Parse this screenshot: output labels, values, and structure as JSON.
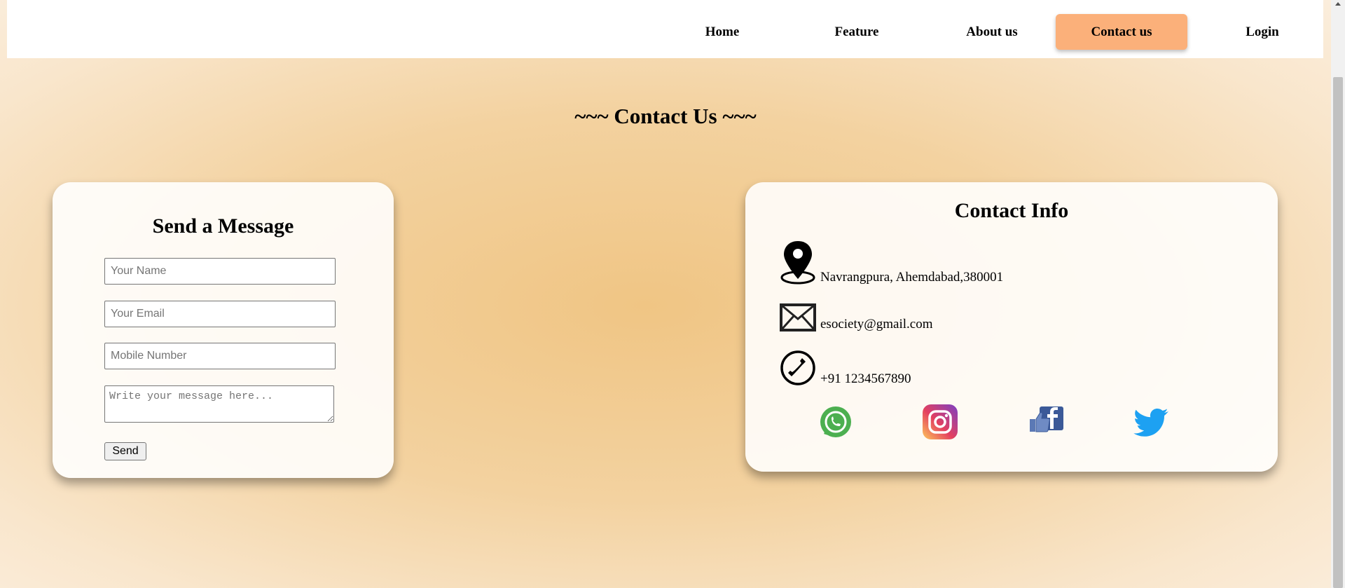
{
  "nav": {
    "items": [
      {
        "label": "Home"
      },
      {
        "label": "Feature"
      },
      {
        "label": "About us"
      },
      {
        "label": "Contact us"
      },
      {
        "label": "Login"
      }
    ]
  },
  "page_title": "~~~ Contact Us ~~~",
  "message_form": {
    "title": "Send a Message",
    "name_placeholder": "Your Name",
    "email_placeholder": "Your Email",
    "mobile_placeholder": "Mobile Number",
    "message_placeholder": "Write your message here...",
    "send_label": "Send"
  },
  "contact_info": {
    "title": "Contact Info",
    "address": "Navrangpura, Ahemdabad,380001",
    "email": "esociety@gmail.com",
    "phone": "+91 1234567890",
    "social": [
      "whatsapp-icon",
      "instagram-icon",
      "facebook-icon",
      "twitter-icon"
    ]
  },
  "colors": {
    "active_nav": "#fbb07a",
    "background_center": "#f0c584"
  }
}
